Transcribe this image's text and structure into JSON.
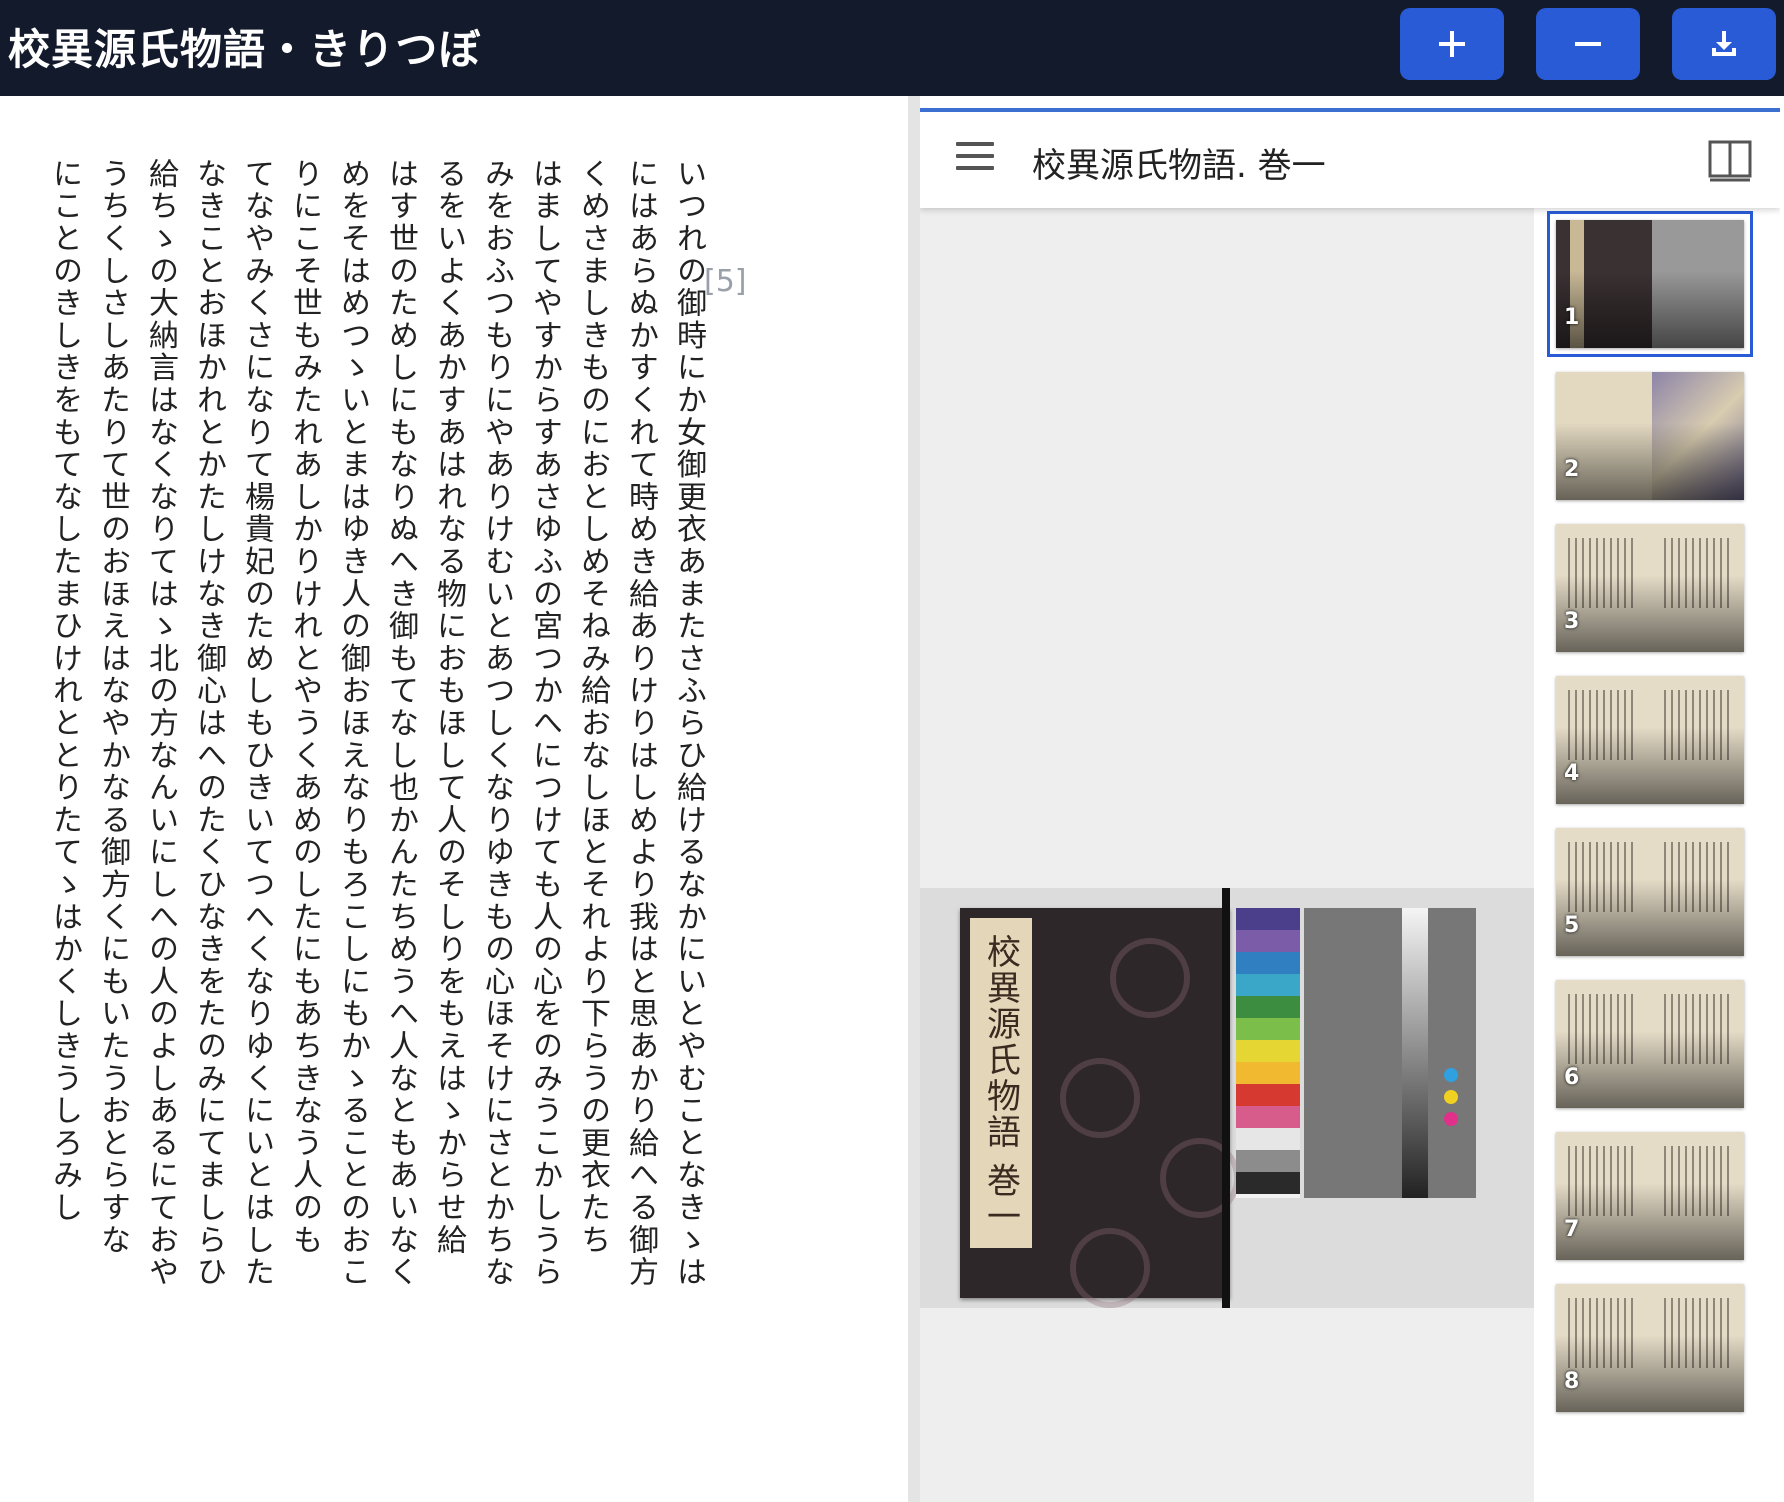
{
  "app": {
    "title": "校異源氏物語・きりつぼ",
    "buttons": [
      {
        "name": "zoom-in",
        "icon": "plus-icon"
      },
      {
        "name": "zoom-out",
        "icon": "minus-icon"
      },
      {
        "name": "download",
        "icon": "download-icon"
      }
    ],
    "accent": "#2a5bd7",
    "header_bg": "#131a2b"
  },
  "text_panel": {
    "page_marker": "[5]",
    "columns": [
      "いつれの御時にか女御更衣あまたさふらひ給けるなかにいとやむことなきゝは",
      "にはあらぬかすくれて時めき給ありけりはしめより我はと思あかり給へる御方",
      "くめさましきものにおとしめそねみ給おなしほとそれより下らうの更衣たち",
      "はましてやすからすあさゆふの宮つかへにつけても人の心をのみうこかしうら",
      "みをおふつもりにやありけむいとあつしくなりゆきもの心ほそけにさとかちな",
      "るをいよくあかすあはれなる物におもほして人のそしりをもえはゝからせ給",
      "はす世のためしにもなりぬへき御もてなし也かんたちめうへ人なともあいなく",
      "めをそはめつゝいとまはゆき人の御おほえなりもろこしにもかゝることのおこ",
      "りにこそ世もみたれあしかりけれとやうくあめのしたにもあちきなう人のも",
      "てなやみくさになりて楊貴妃のためしもひきいてつへくなりゆくにいとはした",
      "なきことおほかれとかたしけなき御心はへのたくひなきをたのみにてましらひ",
      "給ちゝの大納言はなくなりてはゝ北の方なんいにしへの人のよしあるにておや",
      "うちくしさしあたりて世のおほえはなやかなる御方くにもいたうおとらすな",
      "にことのきしきをもてなしたまひけれととりたてゝはかくしきうしろみし"
    ]
  },
  "viewer": {
    "title": "校異源氏物語. 巻一",
    "menu_icon": "hamburger-menu-icon",
    "view_icon": "book-view-icon",
    "cover_label": "校異源氏物語 巻一",
    "color_chart": [
      "#4b3f8c",
      "#7a5ca8",
      "#2f7fc1",
      "#3aa7c9",
      "#3c8d3f",
      "#7bbf4a",
      "#e5d634",
      "#f0b92f",
      "#d6392f",
      "#d75c8c",
      "#e6e6e6",
      "#8c8c8c",
      "#2a2a2a"
    ],
    "thumbnails": [
      {
        "num": "1",
        "selected": true
      },
      {
        "num": "2",
        "selected": false
      },
      {
        "num": "3",
        "selected": false
      },
      {
        "num": "4",
        "selected": false
      },
      {
        "num": "5",
        "selected": false
      },
      {
        "num": "6",
        "selected": false
      },
      {
        "num": "7",
        "selected": false
      },
      {
        "num": "8",
        "selected": false
      }
    ]
  }
}
